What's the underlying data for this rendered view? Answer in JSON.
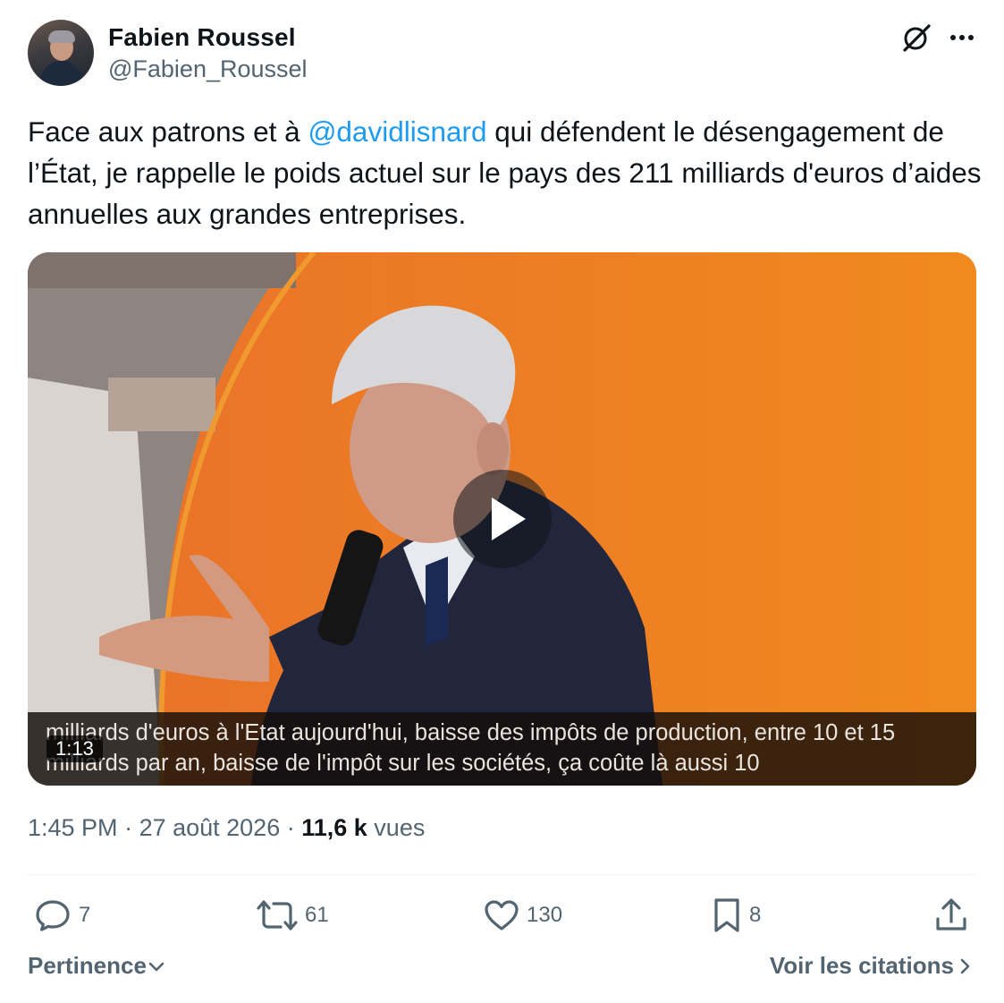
{
  "author": {
    "display_name": "Fabien Roussel",
    "handle": "@Fabien_Roussel"
  },
  "icons": {
    "top_right": [
      "x-logo-icon",
      "more-options-icon"
    ],
    "actions": [
      "reply-icon",
      "repost-icon",
      "like-icon",
      "bookmark-icon",
      "share-icon"
    ]
  },
  "tweet": {
    "text_part1": "Face aux patrons et à ",
    "mention": "@davidlisnard",
    "text_part2": " qui défendent le désengagement de l’État, je rappelle le poids actuel sur le pays des 211 milliards d'euros d’aides annuelles aux grandes entreprises."
  },
  "video": {
    "subtitle_line1": "milliards d'euros à l'Etat aujourd'hui, baisse des impôts de production, entre 10 et 15",
    "subtitle_line2": "milliards par an, baisse de l'impôt sur les sociétés, ça coûte là aussi 10",
    "duration": "1:13"
  },
  "meta": {
    "time": "1:45 PM",
    "separator": " · ",
    "date": "27 août 2026",
    "views_count": "11,6 k",
    "views_label": " vues"
  },
  "actions": {
    "reply": "7",
    "repost": "61",
    "like": "130",
    "bookmark": "8"
  },
  "footer": {
    "sort_label": "Pertinence",
    "quotes_label": "Voir les citations"
  },
  "colors": {
    "link": "#1d9bf0",
    "secondary_text": "#536471",
    "primary_text": "#0f1419",
    "video_background": "#ee7a1e"
  }
}
